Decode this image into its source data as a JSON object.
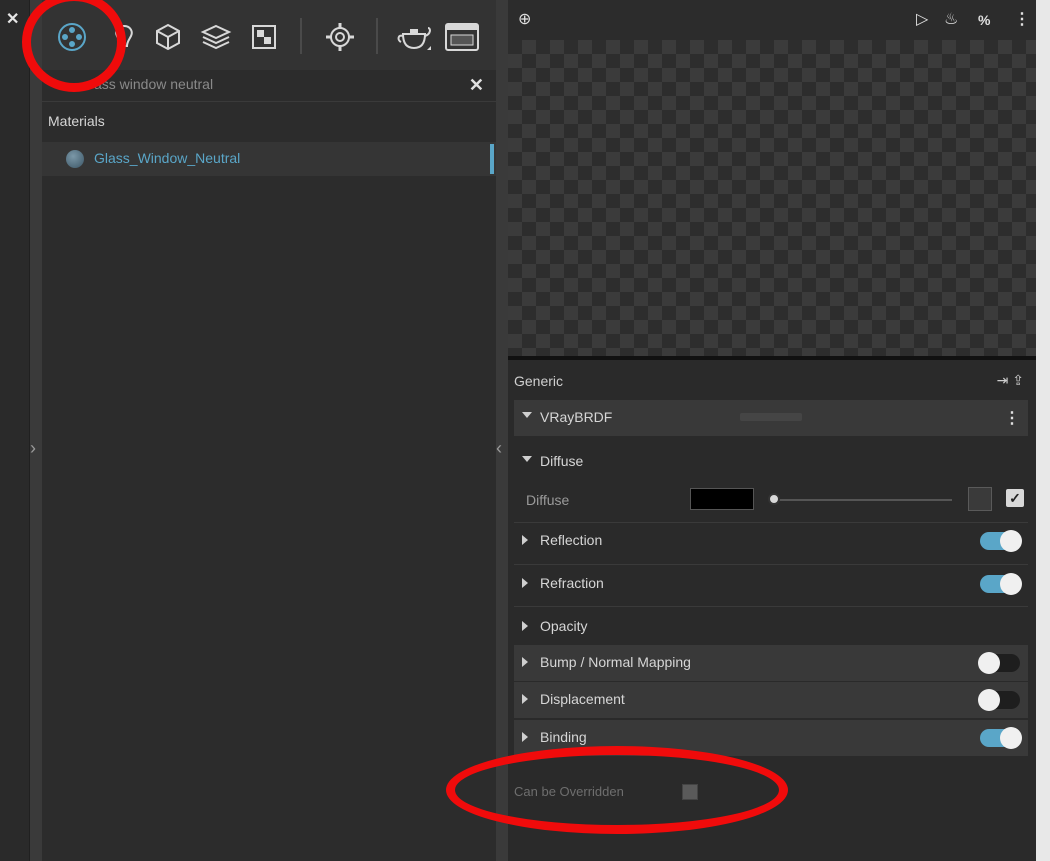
{
  "search": {
    "text": "glass window neutral",
    "visible_text": "ass window neutral"
  },
  "library": {
    "header": "Materials",
    "items": [
      {
        "name": "Glass_Window_Neutral"
      }
    ]
  },
  "properties": {
    "generic_label": "Generic",
    "brdf_label": "VRayBRDF",
    "diffuse_section": "Diffuse",
    "diffuse_param": "Diffuse",
    "sections": [
      {
        "label": "Reflection",
        "toggle": "on"
      },
      {
        "label": "Refraction",
        "toggle": "on"
      },
      {
        "label": "Opacity",
        "toggle": "none"
      },
      {
        "label": "Bump / Normal Mapping",
        "toggle": "off"
      },
      {
        "label": "Displacement",
        "toggle": "off"
      },
      {
        "label": "Binding",
        "toggle": "on"
      }
    ],
    "override_label": "Can be Overridden"
  },
  "colors": {
    "accent": "#5aa6c8",
    "annotation": "#f00b0b",
    "diffuse_swatch": "#000000"
  },
  "icons": {
    "toolbar": [
      "materials-icon",
      "lights-icon",
      "geometry-icon",
      "layers-icon",
      "textures-icon",
      "settings-icon",
      "render-teapot-icon",
      "frame-buffer-icon"
    ],
    "preview": [
      "pin-icon",
      "play-icon",
      "teapot-icon",
      "scene-options-icon",
      "kebab-icon"
    ]
  }
}
